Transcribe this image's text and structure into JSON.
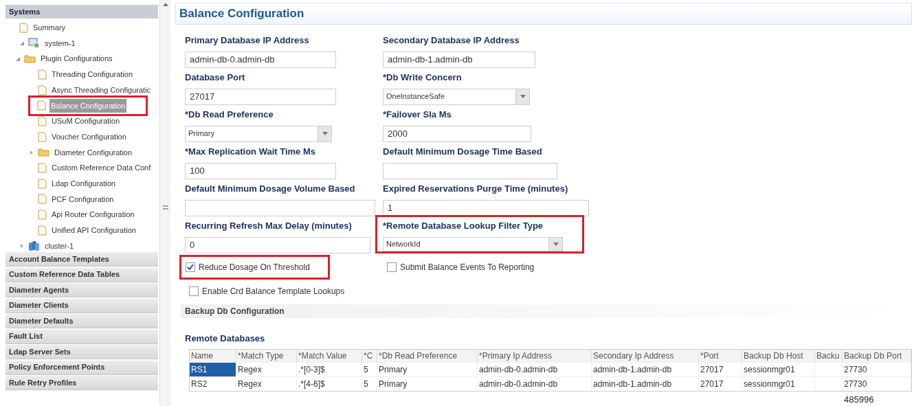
{
  "sidebar": {
    "title": "Systems",
    "tree": [
      {
        "label": "Summary",
        "kind": "page",
        "selected": false,
        "highlighted": false
      },
      {
        "label": "system-1",
        "kind": "system",
        "expanded": true,
        "selected": false,
        "highlighted": false,
        "children": [
          {
            "label": "Plugin Configurations",
            "kind": "folder",
            "expanded": true,
            "selected": false,
            "highlighted": false,
            "children": [
              {
                "label": "Threading Configuration",
                "kind": "page",
                "selected": false,
                "highlighted": false
              },
              {
                "label": "Async Threading Configuratic",
                "kind": "page",
                "selected": false,
                "highlighted": false
              },
              {
                "label": "Balance Configuration",
                "kind": "page",
                "selected": true,
                "highlighted": true
              },
              {
                "label": "USuM Configuration",
                "kind": "page",
                "selected": false,
                "highlighted": false
              },
              {
                "label": "Voucher Configuration",
                "kind": "page",
                "selected": false,
                "highlighted": false
              },
              {
                "label": "Diameter Configuration",
                "kind": "folder",
                "expanded": false,
                "selected": false,
                "highlighted": false
              },
              {
                "label": "Custom Reference Data Conf",
                "kind": "page",
                "selected": false,
                "highlighted": false
              },
              {
                "label": "Ldap Configuration",
                "kind": "page",
                "selected": false,
                "highlighted": false
              },
              {
                "label": "PCF Configuration",
                "kind": "page",
                "selected": false,
                "highlighted": false
              },
              {
                "label": "Api Router Configuration",
                "kind": "page",
                "selected": false,
                "highlighted": false
              },
              {
                "label": "Unified API Configuration",
                "kind": "page",
                "selected": false,
                "highlighted": false
              }
            ]
          }
        ]
      },
      {
        "label": "cluster-1",
        "kind": "cluster",
        "expanded": false,
        "selected": false,
        "highlighted": false
      }
    ],
    "sections": [
      "Account Balance Templates",
      "Custom Reference Data Tables",
      "Diameter Agents",
      "Diameter Clients",
      "Diameter Defaults",
      "Fault List",
      "Ldap Server Sets",
      "Policy Enforcement Points",
      "Rule Retry Profiles"
    ]
  },
  "panel": {
    "title": "Balance Configuration",
    "fields": [
      {
        "label": "Primary Database IP Address",
        "value": "admin-db-0.admin-db",
        "kind": "text",
        "highlighted": false
      },
      {
        "label": "Secondary Database IP Address",
        "value": "admin-db-1.admin-db",
        "kind": "text",
        "highlighted": false
      },
      {
        "label": "Database Port",
        "value": "27017",
        "kind": "text",
        "highlighted": false
      },
      {
        "label": "*Db Write Concern",
        "value": "OneInstanceSafe",
        "kind": "select",
        "highlighted": false
      },
      {
        "label": "*Db Read Preference",
        "value": "Primary",
        "kind": "select",
        "highlighted": false
      },
      {
        "label": "*Failover Sla Ms",
        "value": "2000",
        "kind": "text",
        "highlighted": false
      },
      {
        "label": "*Max Replication Wait Time Ms",
        "value": "100",
        "kind": "text",
        "highlighted": false
      },
      {
        "label": "Default Minimum Dosage Time Based",
        "kind": "text",
        "highlighted": false
      },
      {
        "label": "Default Minimum Dosage Volume Based",
        "kind": "text",
        "highlighted": false
      },
      {
        "label": "Expired Reservations Purge Time (minutes)",
        "value": "1",
        "kind": "text",
        "highlighted": false
      },
      {
        "label": "Recurring Refresh Max Delay (minutes)",
        "value": "0",
        "kind": "text",
        "highlighted": false
      },
      {
        "label": "*Remote Database Lookup Filter Type",
        "value": "NetworkId",
        "kind": "select",
        "highlighted": true
      }
    ],
    "checkboxes": [
      {
        "label": "Reduce Dosage On Threshold",
        "checked": true,
        "highlighted": true
      },
      {
        "label": "Submit Balance Events To Reporting",
        "checked": false,
        "highlighted": false
      },
      {
        "label": "Enable Crd Balance Template Lookups",
        "checked": false,
        "highlighted": false
      }
    ],
    "backup_section": "Backup Db Configuration",
    "table": {
      "title": "Remote Databases",
      "columns": [
        "Name",
        "*Match Type",
        "*Match Value",
        "*C",
        "*Db Read Preference",
        "*Primary Ip Address",
        "Secondary Ip Address",
        "*Port",
        "Backup Db Host",
        "Backu",
        "Backup Db Port"
      ],
      "rows": [
        {
          "selected": true,
          "cells": [
            "RS1",
            "Regex",
            ".*[0-3]$",
            "5",
            "Primary",
            "admin-db-0.admin-db",
            "admin-db-1.admin-db",
            "27017",
            "sessionmgr01",
            "",
            "27730"
          ]
        },
        {
          "selected": false,
          "cells": [
            "RS2",
            "Regex",
            ".*[4-6]$",
            "5",
            "Primary",
            "admin-db-0.admin-db",
            "admin-db-1.admin-db",
            "27017",
            "sessionmgr01",
            "",
            "27730"
          ]
        }
      ]
    },
    "figure_number": "485996"
  }
}
